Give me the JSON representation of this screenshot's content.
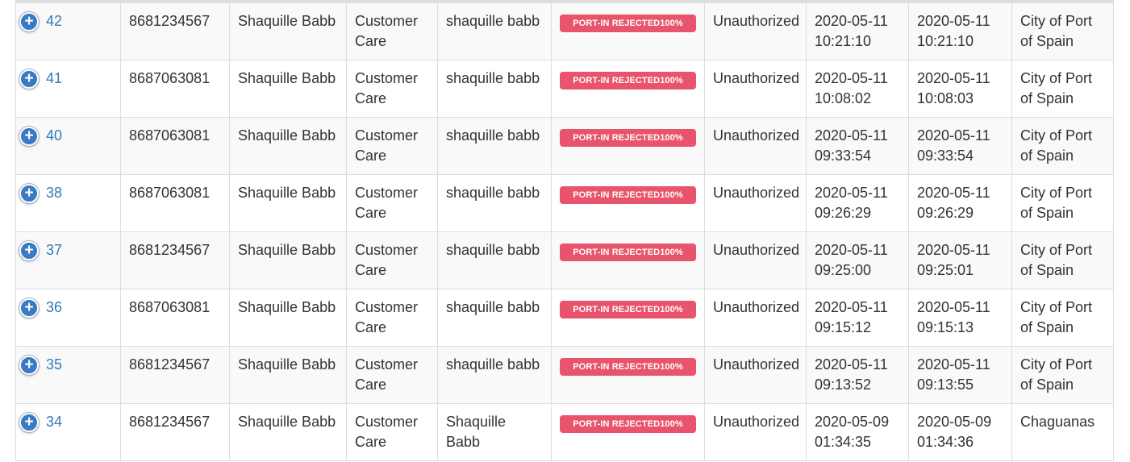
{
  "colors": {
    "badge": "#e8546b",
    "link": "#337ab7",
    "expand_icon": "#3a79c4"
  },
  "rows": [
    {
      "id": "42",
      "phone": "8681234567",
      "customer": "Shaquille Babb",
      "department": "Customer Care",
      "agent": "shaquille babb",
      "status": "PORT-IN REJECTED100%",
      "auth": "Unauthorized",
      "created_date": "2020-05-11",
      "created_time": "10:21:10",
      "updated_date": "2020-05-11",
      "updated_time": "10:21:10",
      "location": "City of Port of Spain"
    },
    {
      "id": "41",
      "phone": "8687063081",
      "customer": "Shaquille Babb",
      "department": "Customer Care",
      "agent": "shaquille babb",
      "status": "PORT-IN REJECTED100%",
      "auth": "Unauthorized",
      "created_date": "2020-05-11",
      "created_time": "10:08:02",
      "updated_date": "2020-05-11",
      "updated_time": "10:08:03",
      "location": "City of Port of Spain"
    },
    {
      "id": "40",
      "phone": "8687063081",
      "customer": "Shaquille Babb",
      "department": "Customer Care",
      "agent": "shaquille babb",
      "status": "PORT-IN REJECTED100%",
      "auth": "Unauthorized",
      "created_date": "2020-05-11",
      "created_time": "09:33:54",
      "updated_date": "2020-05-11",
      "updated_time": "09:33:54",
      "location": "City of Port of Spain"
    },
    {
      "id": "38",
      "phone": "8687063081",
      "customer": "Shaquille Babb",
      "department": "Customer Care",
      "agent": "shaquille babb",
      "status": "PORT-IN REJECTED100%",
      "auth": "Unauthorized",
      "created_date": "2020-05-11",
      "created_time": "09:26:29",
      "updated_date": "2020-05-11",
      "updated_time": "09:26:29",
      "location": "City of Port of Spain"
    },
    {
      "id": "37",
      "phone": "8681234567",
      "customer": "Shaquille Babb",
      "department": "Customer Care",
      "agent": "shaquille babb",
      "status": "PORT-IN REJECTED100%",
      "auth": "Unauthorized",
      "created_date": "2020-05-11",
      "created_time": "09:25:00",
      "updated_date": "2020-05-11",
      "updated_time": "09:25:01",
      "location": "City of Port of Spain"
    },
    {
      "id": "36",
      "phone": "8687063081",
      "customer": "Shaquille Babb",
      "department": "Customer Care",
      "agent": "shaquille babb",
      "status": "PORT-IN REJECTED100%",
      "auth": "Unauthorized",
      "created_date": "2020-05-11",
      "created_time": "09:15:12",
      "updated_date": "2020-05-11",
      "updated_time": "09:15:13",
      "location": "City of Port of Spain"
    },
    {
      "id": "35",
      "phone": "8681234567",
      "customer": "Shaquille Babb",
      "department": "Customer Care",
      "agent": "shaquille babb",
      "status": "PORT-IN REJECTED100%",
      "auth": "Unauthorized",
      "created_date": "2020-05-11",
      "created_time": "09:13:52",
      "updated_date": "2020-05-11",
      "updated_time": "09:13:55",
      "location": "City of Port of Spain"
    },
    {
      "id": "34",
      "phone": "8681234567",
      "customer": "Shaquille Babb",
      "department": "Customer Care",
      "agent": "Shaquille Babb",
      "status": "PORT-IN REJECTED100%",
      "auth": "Unauthorized",
      "created_date": "2020-05-09",
      "created_time": "01:34:35",
      "updated_date": "2020-05-09",
      "updated_time": "01:34:36",
      "location": "Chaguanas"
    }
  ]
}
